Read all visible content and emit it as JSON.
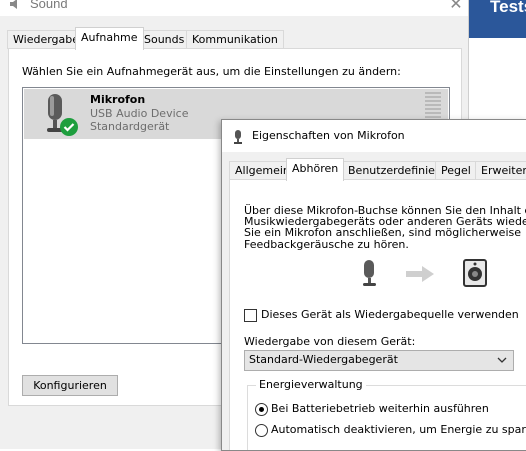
{
  "background": {
    "app_title_fragment": "Tests"
  },
  "sound_window": {
    "title": "Sound",
    "tabs": [
      {
        "label": "Wiedergabe"
      },
      {
        "label": "Aufnahme"
      },
      {
        "label": "Sounds"
      },
      {
        "label": "Kommunikation"
      }
    ],
    "active_tab": "Aufnahme",
    "instruction": "Wählen Sie ein Aufnahmegerät aus, um die Einstellungen zu ändern:",
    "devices": [
      {
        "name": "Mikrofon",
        "detail": "USB Audio Device",
        "status": "Standardgerät"
      }
    ],
    "configure_label": "Konfigurieren"
  },
  "properties_dialog": {
    "title": "Eigenschaften von Mikrofon",
    "tabs": [
      {
        "label": "Allgemein"
      },
      {
        "label": "Abhören"
      },
      {
        "label": "Benutzerdefiniert"
      },
      {
        "label": "Pegel"
      },
      {
        "label": "Erweitert"
      }
    ],
    "active_tab": "Abhören",
    "description_lines": [
      "Über diese Mikrofon-Buchse können Sie den Inhalt eines",
      "Musikwiedergabegeräts oder anderen Geräts wiedergeben,",
      "Sie ein Mikrofon anschließen, sind möglicherweise",
      "Feedbackgeräusche zu hören."
    ],
    "listen_checkbox": {
      "label": "Dieses Gerät als Wiedergabequelle verwenden",
      "checked": false
    },
    "playback_label": "Wiedergabe von diesem Gerät:",
    "playback_select": "Standard-Wiedergabegerät",
    "power_group": {
      "title": "Energieverwaltung",
      "options": [
        {
          "label": "Bei Batteriebetrieb weiterhin ausführen",
          "selected": true
        },
        {
          "label": "Automatisch deaktivieren, um Energie zu sparen",
          "selected": false
        }
      ]
    }
  },
  "colors": {
    "accent_blue": "#2b579a",
    "selected_row": "#d9d9d9",
    "default_badge_green": "#1e9e3e"
  },
  "icons": [
    "speaker-icon",
    "microphone-icon",
    "default-check-icon",
    "arrow-right-icon",
    "speaker-box-icon",
    "close-icon",
    "chevron-down-icon"
  ]
}
